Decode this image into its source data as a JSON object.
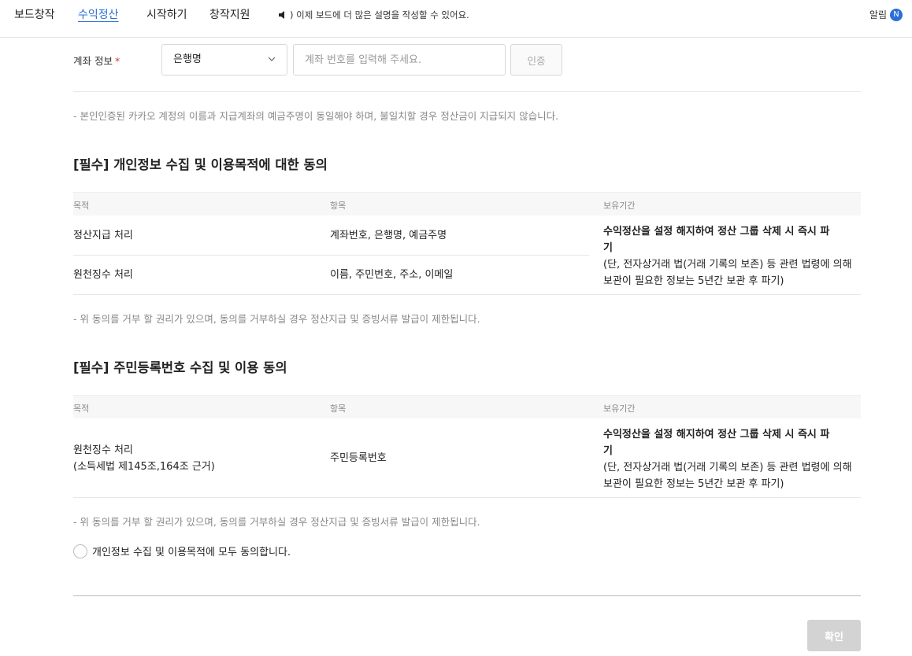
{
  "nav": {
    "items": [
      {
        "label": "보드창작"
      },
      {
        "label": "수익정산"
      },
      {
        "label": "시작하기"
      },
      {
        "label": "창작지원"
      }
    ],
    "notice": ") 이제 보드에 더 많은 설명을 작성할 수 있어요.",
    "alarm_label": "알림",
    "alarm_badge": "N"
  },
  "account": {
    "label": "계좌 정보",
    "required_mark": "*",
    "bank_selected": "은행명",
    "number_placeholder": "계좌 번호를 입력해 주세요.",
    "auth_button": "인증",
    "note": "- 본인인증된 카카오 계정의 이름과 지급계좌의 예금주명이 동일해야 하며, 불일치할 경우 정산금이 지급되지 않습니다."
  },
  "privacy": {
    "title": "[필수] 개인정보 수집 및 이용목적에 대한 동의",
    "headers": [
      "목적",
      "항목",
      "보유기간"
    ],
    "rows": [
      {
        "purpose": "정산지급 처리",
        "items": "계좌번호, 은행명, 예금주명"
      },
      {
        "purpose": "원천징수 처리",
        "items": "이름, 주민번호, 주소, 이메일"
      }
    ],
    "retain_main_1": "수익정산을 설정 해지하여 정산 그룹 삭제 시 즉시 파",
    "retain_main_2": "기",
    "retain_sub_1": "(단, 전자상거래 법(거래 기록의 보존) 등 관련 법령에 의해",
    "retain_sub_2": "보관이 필요한 정보는 5년간 보관 후 파기)",
    "note": "- 위 동의를 거부 할 권리가 있으며, 동의를 거부하실 경우 정산지급 및 증빙서류 발급이 제한됩니다."
  },
  "resident": {
    "title": "[필수] 주민등록번호 수집 및 이용 동의",
    "headers": [
      "목적",
      "항목",
      "보유기간"
    ],
    "purpose_1": "원천징수 처리",
    "purpose_2": "(소득세법 제145조,164조 근거)",
    "items": "주민등록번호",
    "retain_main_1": "수익정산을 설정 해지하여 정산 그룹 삭제 시 즉시 파",
    "retain_main_2": "기",
    "retain_sub_1": "(단, 전자상거래 법(거래 기록의 보존) 등 관련 법령에 의해",
    "retain_sub_2": "보관이 필요한 정보는 5년간 보관 후 파기)",
    "note": "- 위 동의를 거부 할 권리가 있으며, 동의를 거부하실 경우 정산지급 및 증빙서류 발급이 제한됩니다."
  },
  "agree_all": "개인정보 수집 및 이용목적에 모두 동의합니다.",
  "confirm_button": "확인",
  "colors": {
    "accent": "#2b6fd6",
    "required": "#e0312b",
    "disabled": "#d3d3d3"
  }
}
